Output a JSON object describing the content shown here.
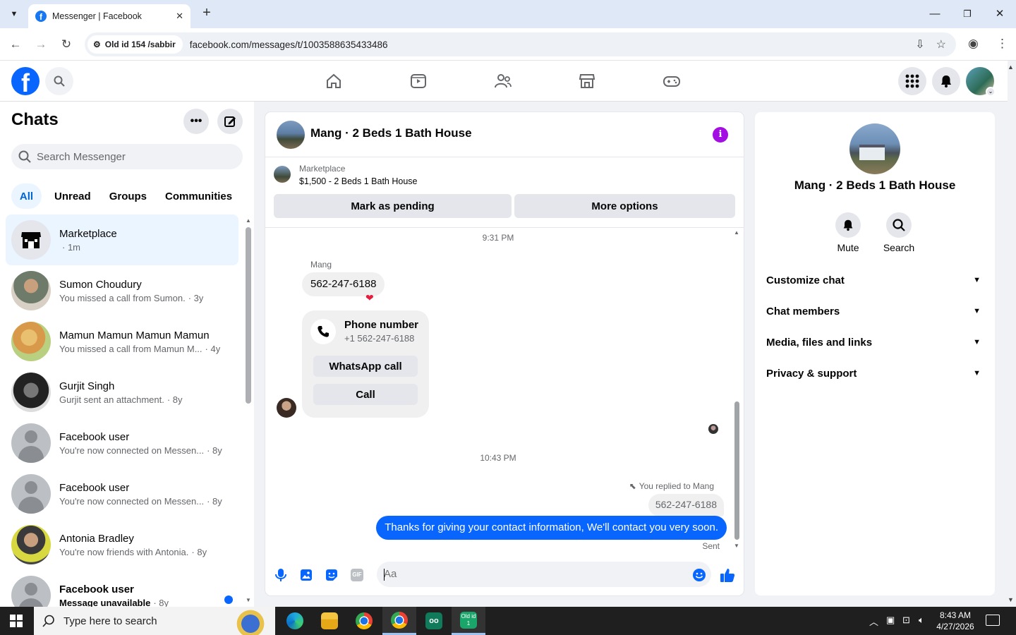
{
  "browser": {
    "tab_title": "Messenger | Facebook",
    "site_chip": "Old id 154 /sabbir",
    "url": "facebook.com/messages/t/1003588635433486"
  },
  "chats": {
    "title": "Chats",
    "search_placeholder": "Search Messenger",
    "filters": [
      "All",
      "Unread",
      "Groups",
      "Communities"
    ],
    "items": [
      {
        "name": "Marketplace",
        "snippet": "",
        "time": "· 1m"
      },
      {
        "name": "Sumon Choudury",
        "snippet": "You missed a call from Sumon.",
        "time": "· 3y"
      },
      {
        "name": "Mamun Mamun Mamun Mamun",
        "snippet": "You missed a call from Mamun M...",
        "time": "· 4y"
      },
      {
        "name": "Gurjit Singh",
        "snippet": "Gurjit sent an attachment.",
        "time": "· 8y"
      },
      {
        "name": "Facebook user",
        "snippet": "You're now connected on Messen...",
        "time": "· 8y"
      },
      {
        "name": "Facebook user",
        "snippet": "You're now connected on Messen...",
        "time": "· 8y"
      },
      {
        "name": "Antonia Bradley",
        "snippet": "You're now friends with Antonia.",
        "time": "· 8y"
      },
      {
        "name": "Facebook user",
        "snippet": "Message unavailable",
        "time": "· 8y"
      }
    ]
  },
  "conversation": {
    "title": "Mang · 2 Beds 1 Bath House",
    "marketplace_label": "Marketplace",
    "listing": "$1,500 - 2 Beds 1 Bath House",
    "mark_pending": "Mark as pending",
    "more_options": "More options",
    "time1": "9:31 PM",
    "sender": "Mang",
    "incoming_text": "562-247-6188",
    "card_title": "Phone number",
    "card_number": "+1 562-247-6188",
    "whatsapp_call": "WhatsApp call",
    "call": "Call",
    "time2": "10:43 PM",
    "replied_label": "You replied to Mang",
    "reply_quote": "562-247-6188",
    "outgoing_text": "Thanks for giving your contact information, We'll contact you very soon.",
    "sent_status": "Sent",
    "composer_placeholder": "Aa",
    "gif_label": "GIF"
  },
  "details": {
    "name": "Mang · 2 Beds 1 Bath House",
    "mute": "Mute",
    "search": "Search",
    "sections": [
      "Customize chat",
      "Chat members",
      "Media, files and links",
      "Privacy & support"
    ]
  },
  "taskbar": {
    "search_placeholder": "Type here to search",
    "time": "8:43 AM",
    "date": "4/27/2026",
    "oldid_label": "Old id 1"
  },
  "colors": {
    "fb_blue": "#0866ff",
    "info_purple": "#a30ee3",
    "selected_chat_bg": "#ebf5ff"
  }
}
